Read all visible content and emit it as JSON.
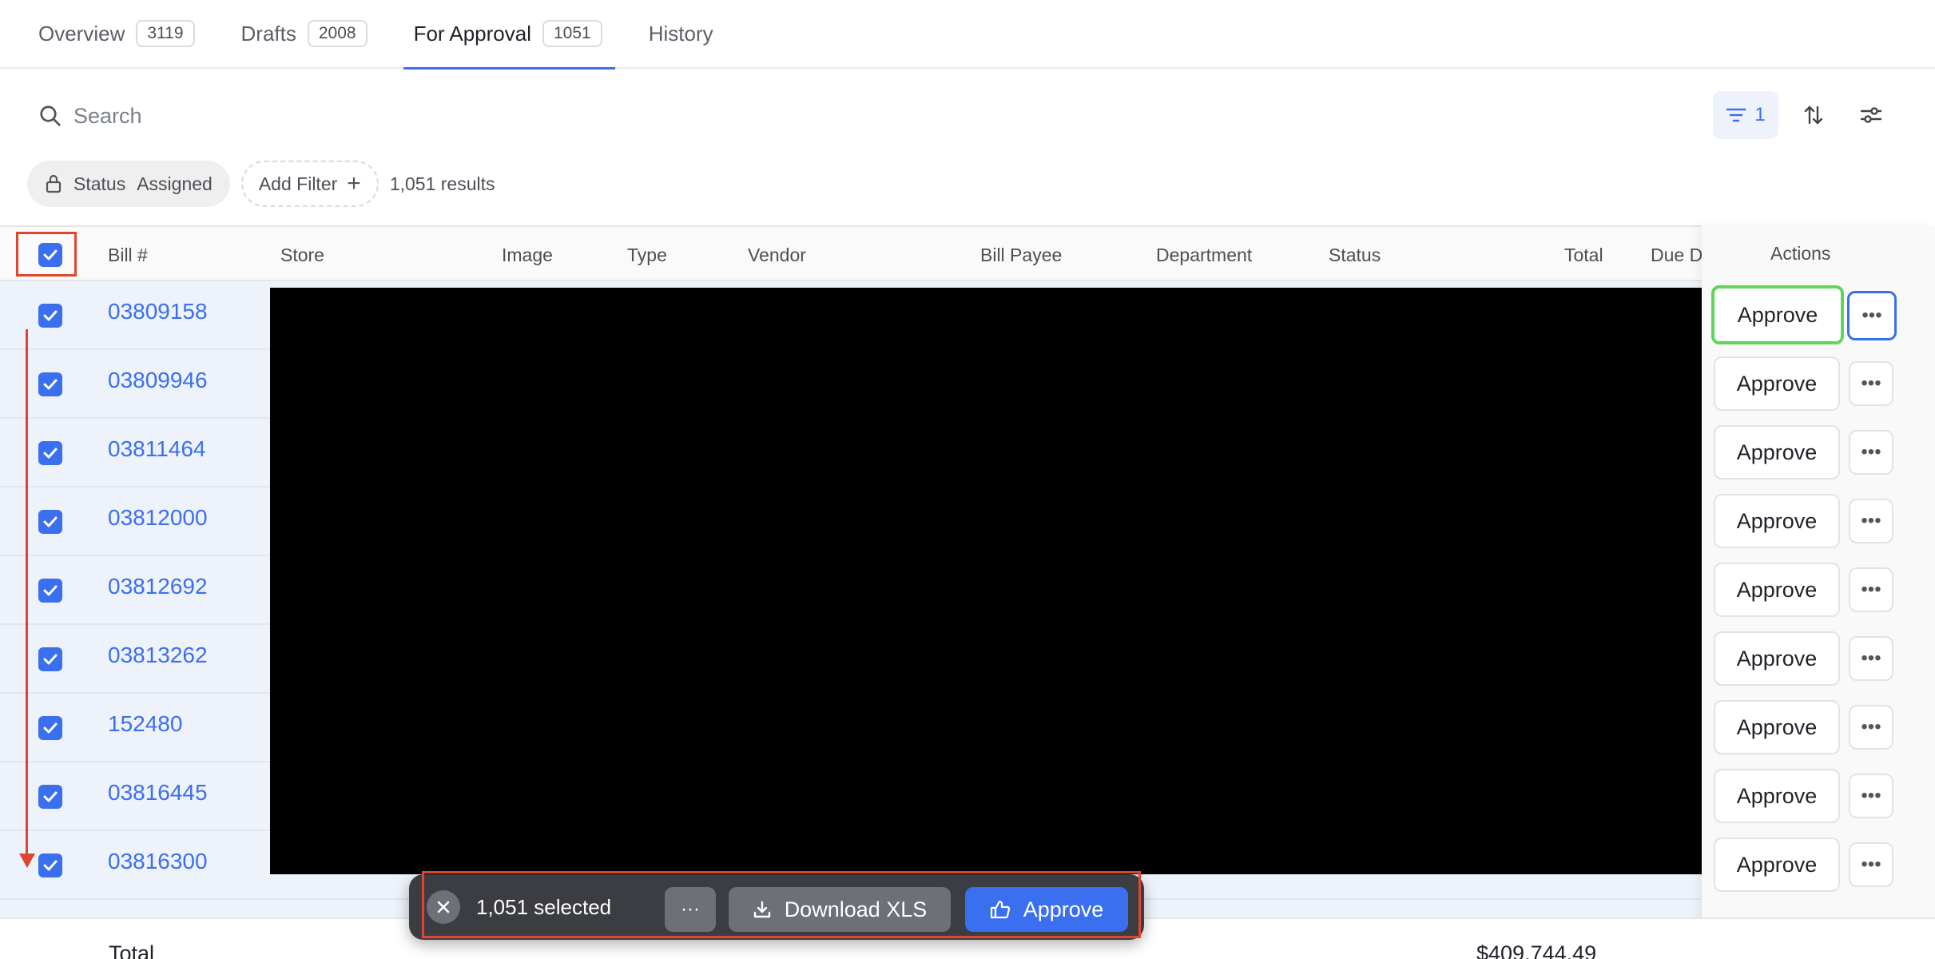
{
  "tabs": [
    {
      "label": "Overview",
      "count": "3119"
    },
    {
      "label": "Drafts",
      "count": "2008"
    },
    {
      "label": "For Approval",
      "count": "1051"
    },
    {
      "label": "History",
      "count": ""
    }
  ],
  "search": {
    "placeholder": "Search"
  },
  "filter_button": {
    "count": "1"
  },
  "chips": {
    "status_label": "Status",
    "status_value": "Assigned",
    "add_filter": "Add Filter",
    "results": "1,051 results"
  },
  "columns": {
    "bill": "Bill #",
    "store": "Store",
    "image": "Image",
    "type": "Type",
    "vendor": "Vendor",
    "bill_payee": "Bill Payee",
    "department": "Department",
    "status": "Status",
    "total": "Total",
    "due": "Due D",
    "actions": "Actions"
  },
  "rows": [
    {
      "bill": "03809158",
      "action": "Approve"
    },
    {
      "bill": "03809946",
      "action": "Approve"
    },
    {
      "bill": "03811464",
      "action": "Approve"
    },
    {
      "bill": "03812000",
      "action": "Approve"
    },
    {
      "bill": "03812692",
      "action": "Approve"
    },
    {
      "bill": "03813262",
      "action": "Approve"
    },
    {
      "bill": "152480",
      "action": "Approve"
    },
    {
      "bill": "03816445",
      "action": "Approve"
    },
    {
      "bill": "03816300",
      "action": "Approve"
    }
  ],
  "totals": {
    "label": "Total",
    "value": "$409,744.49"
  },
  "bulk_bar": {
    "selected": "1,051 selected",
    "more": "···",
    "download": "Download XLS",
    "approve": "Approve"
  },
  "colors": {
    "accent": "#3a6ff0",
    "annotation_red": "#e0452f",
    "annotation_green": "#5ed65a",
    "bulk_bar": "#3b3d42"
  }
}
